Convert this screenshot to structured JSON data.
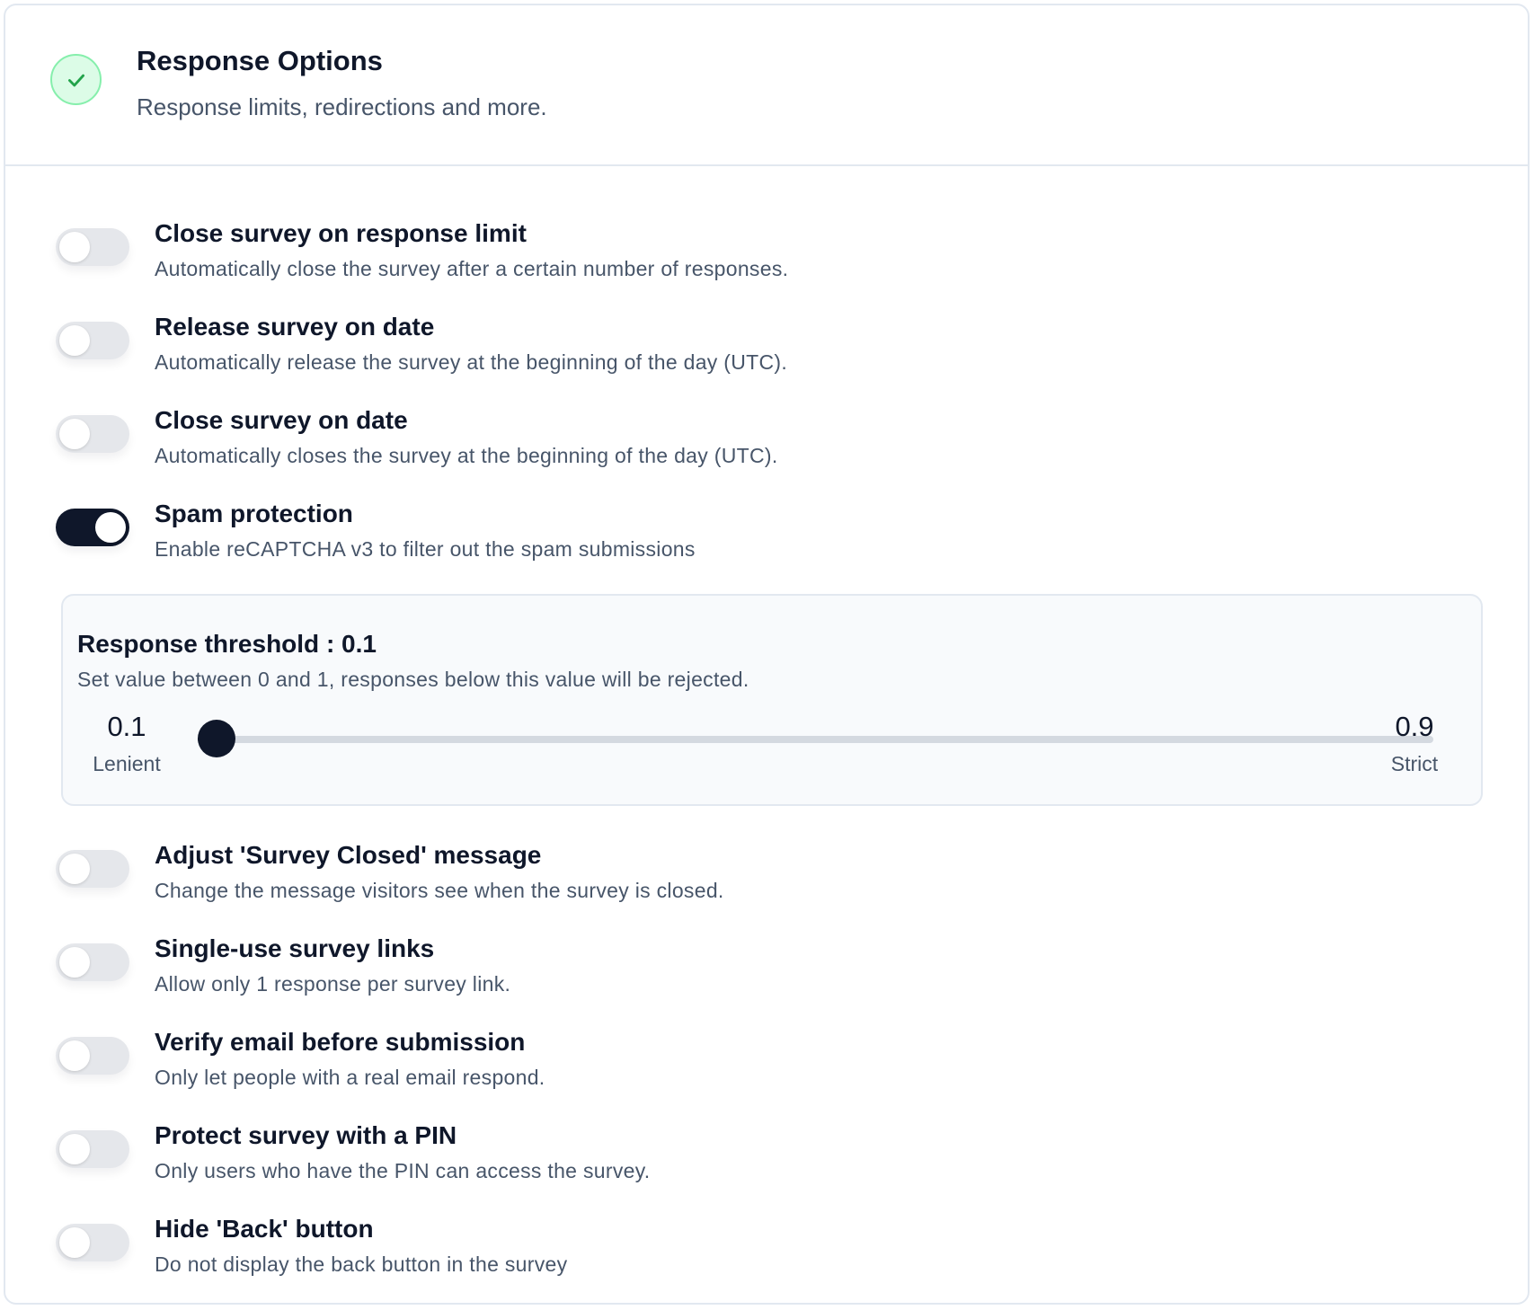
{
  "header": {
    "title": "Response Options",
    "subtitle": "Response limits, redirections and more.",
    "status_icon": "check-icon",
    "status_color": "#22c55e"
  },
  "options_top": [
    {
      "title": "Close survey on response limit",
      "description": "Automatically close the survey after a certain number of responses.",
      "enabled": false
    },
    {
      "title": "Release survey on date",
      "description": "Automatically release the survey at the beginning of the day (UTC).",
      "enabled": false
    },
    {
      "title": "Close survey on date",
      "description": "Automatically closes the survey at the beginning of the day (UTC).",
      "enabled": false
    },
    {
      "title": "Spam protection",
      "description": "Enable reCAPTCHA v3 to filter out the spam submissions",
      "enabled": true
    }
  ],
  "threshold": {
    "title": "Response threshold : 0.1",
    "description": "Set value between 0 and 1, responses below this value will be rejected.",
    "value": 0.1,
    "min_value": "0.1",
    "min_label": "Lenient",
    "max_value": "0.9",
    "max_label": "Strict",
    "min": 0.1,
    "max": 0.9
  },
  "options_bottom": [
    {
      "title": "Adjust 'Survey Closed' message",
      "description": "Change the message visitors see when the survey is closed.",
      "enabled": false
    },
    {
      "title": "Single-use survey links",
      "description": "Allow only 1 response per survey link.",
      "enabled": false
    },
    {
      "title": "Verify email before submission",
      "description": "Only let people with a real email respond.",
      "enabled": false
    },
    {
      "title": "Protect survey with a PIN",
      "description": "Only users who have the PIN can access the survey.",
      "enabled": false
    },
    {
      "title": "Hide 'Back' button",
      "description": "Do not display the back button in the survey",
      "enabled": false
    }
  ],
  "colors": {
    "accent": "#0f172a",
    "toggle_off": "#e5e7eb",
    "muted_text": "#475569",
    "border": "#e2e8f0"
  }
}
